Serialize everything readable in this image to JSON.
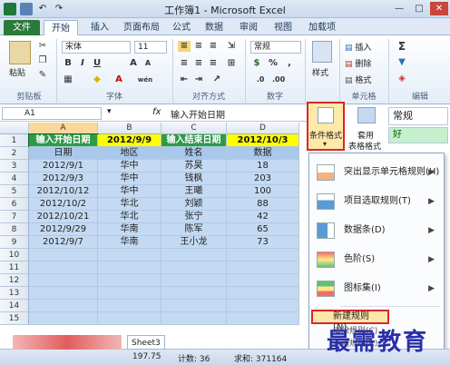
{
  "window": {
    "title": "工作簿1 - Microsoft Excel"
  },
  "tabs": [
    "文件",
    "开始",
    "插入",
    "页面布局",
    "公式",
    "数据",
    "审阅",
    "视图",
    "加载项"
  ],
  "ribbon": {
    "clipboard": {
      "paste_label": "粘贴",
      "group_label": "剪贴板"
    },
    "font": {
      "font_name": "宋体",
      "font_size": "11",
      "bold": "B",
      "italic": "I",
      "underline": "U",
      "grow": "A",
      "shrink": "A",
      "wen": "wén",
      "group_label": "字体"
    },
    "align": {
      "group_label": "对齐方式"
    },
    "number": {
      "format": "常规",
      "group_label": "数字"
    },
    "styles": {
      "label": "样式",
      "group_label": "样式"
    },
    "cells": {
      "insert": "插入",
      "delete": "删除",
      "format": "格式",
      "group_label": "单元格"
    },
    "edit": {
      "sigma": "Σ",
      "group_label": "编辑"
    }
  },
  "formula_bar": {
    "cell_ref": "A1",
    "fx": "fx",
    "content": "输入开始日期"
  },
  "style_panel": {
    "conditional_label": "条件格式",
    "table_label": "套用",
    "table_label2": "表格格式",
    "normal": "常规",
    "good": "好"
  },
  "sheet": {
    "columns": [
      "A",
      "B",
      "C",
      "D"
    ],
    "rows": [
      [
        "输入开始日期",
        "2012/9/9",
        "输入结束日期",
        "2012/10/3"
      ],
      [
        "日期",
        "地区",
        "姓名",
        "数据"
      ],
      [
        "2012/9/1",
        "华中",
        "苏昊",
        "18"
      ],
      [
        "2012/9/3",
        "华中",
        "钱枫",
        "203"
      ],
      [
        "2012/10/12",
        "华中",
        "王曦",
        "100"
      ],
      [
        "2012/10/2",
        "华北",
        "刘颖",
        "88"
      ],
      [
        "2012/10/21",
        "华北",
        "张宁",
        "42"
      ],
      [
        "2012/9/29",
        "华南",
        "陈军",
        "65"
      ],
      [
        "2012/9/7",
        "华南",
        "王小龙",
        "73"
      ],
      [
        "",
        "",
        "",
        ""
      ],
      [
        "",
        "",
        "",
        ""
      ],
      [
        "",
        "",
        "",
        ""
      ],
      [
        "",
        "",
        "",
        ""
      ],
      [
        "",
        "",
        "",
        ""
      ],
      [
        "",
        "",
        "",
        ""
      ]
    ],
    "row_numbers": [
      "1",
      "2",
      "3",
      "4",
      "5",
      "6",
      "7",
      "8",
      "9",
      "10",
      "11",
      "12",
      "13",
      "14",
      "15"
    ]
  },
  "menu": {
    "items": [
      {
        "label": "突出显示单元格规则(H)",
        "arrow": "▶"
      },
      {
        "label": "项目选取规则(T)",
        "arrow": "▶"
      },
      {
        "label": "数据条(D)",
        "arrow": "▶"
      },
      {
        "label": "色阶(S)",
        "arrow": "▶"
      },
      {
        "label": "图标集(I)",
        "arrow": "▶"
      }
    ],
    "new_rule": "新建规则(N)...",
    "clear_rules": "清除规则(C)",
    "manage_rules": "管理规则(R)..."
  },
  "status": {
    "sheet_tab": "Sheet3",
    "average": "197.75",
    "count": "计数: 36",
    "sum": "求和: 371164"
  },
  "watermark": "最需教育",
  "colors": {
    "header_green": "#2f9b46",
    "header_yellow": "#ffff00",
    "data_blue": "#c4daf2",
    "highlight_red": "#d9262c"
  }
}
